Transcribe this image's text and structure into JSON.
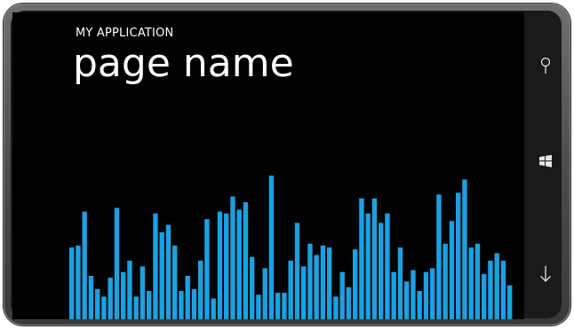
{
  "app": {
    "title": "MY APPLICATION",
    "page_title": "page name"
  },
  "hardware_buttons": [
    {
      "name": "search-icon"
    },
    {
      "name": "windows-start-icon"
    },
    {
      "name": "back-arrow-icon"
    }
  ],
  "colors": {
    "screen_background": "#000000",
    "accent_bar": "#1BA1E2",
    "text": "#ffffff"
  },
  "chart_data": {
    "type": "bar",
    "values": [
      0.38,
      0.39,
      0.57,
      0.23,
      0.16,
      0.12,
      0.22,
      0.59,
      0.25,
      0.31,
      0.12,
      0.28,
      0.15,
      0.56,
      0.46,
      0.5,
      0.39,
      0.15,
      0.23,
      0.16,
      0.31,
      0.53,
      0.11,
      0.57,
      0.56,
      0.65,
      0.58,
      0.62,
      0.33,
      0.13,
      0.27,
      0.76,
      0.14,
      0.14,
      0.31,
      0.51,
      0.28,
      0.4,
      0.34,
      0.39,
      0.38,
      0.12,
      0.25,
      0.17,
      0.37,
      0.64,
      0.56,
      0.64,
      0.51,
      0.56,
      0.25,
      0.38,
      0.2,
      0.26,
      0.15,
      0.25,
      0.27,
      0.66,
      0.4,
      0.52,
      0.67,
      0.74,
      0.38,
      0.4,
      0.24,
      0.31,
      0.35,
      0.31,
      0.18
    ]
  }
}
